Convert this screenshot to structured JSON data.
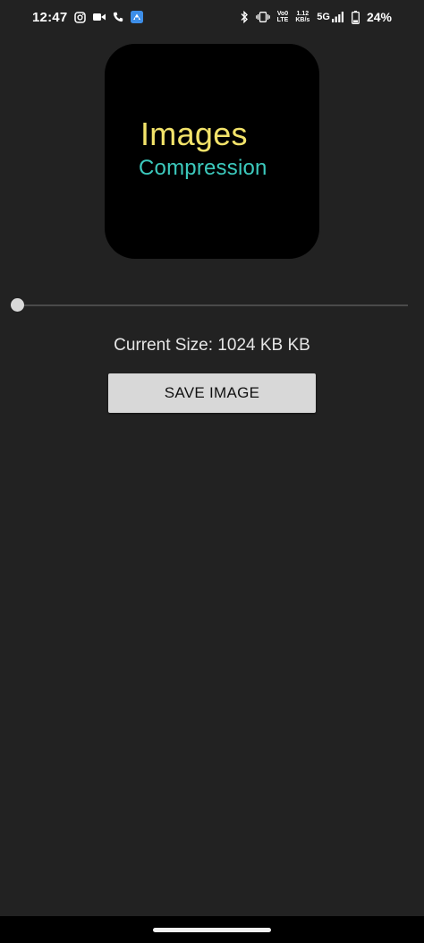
{
  "status_bar": {
    "time": "12:47",
    "volte_line1": "Vo0",
    "volte_line2": "LTE",
    "speed_value": "1.12",
    "speed_unit": "KB/s",
    "network": "5G",
    "battery": "24%",
    "icons": [
      "instagram-icon",
      "video-icon",
      "phone-icon",
      "app-notification-icon",
      "bluetooth-icon",
      "vibrate-icon",
      "signal-icon",
      "battery-icon"
    ]
  },
  "logo": {
    "title": "Images",
    "subtitle": "Compression",
    "title_color": "#f3e36a",
    "subtitle_color": "#3cc9bd"
  },
  "slider": {
    "value_fraction": 0.0
  },
  "size_label": "Current Size: 1024 KB KB",
  "save_button_label": "SAVE IMAGE",
  "colors": {
    "background": "#222222",
    "button": "#d8d8d8"
  }
}
